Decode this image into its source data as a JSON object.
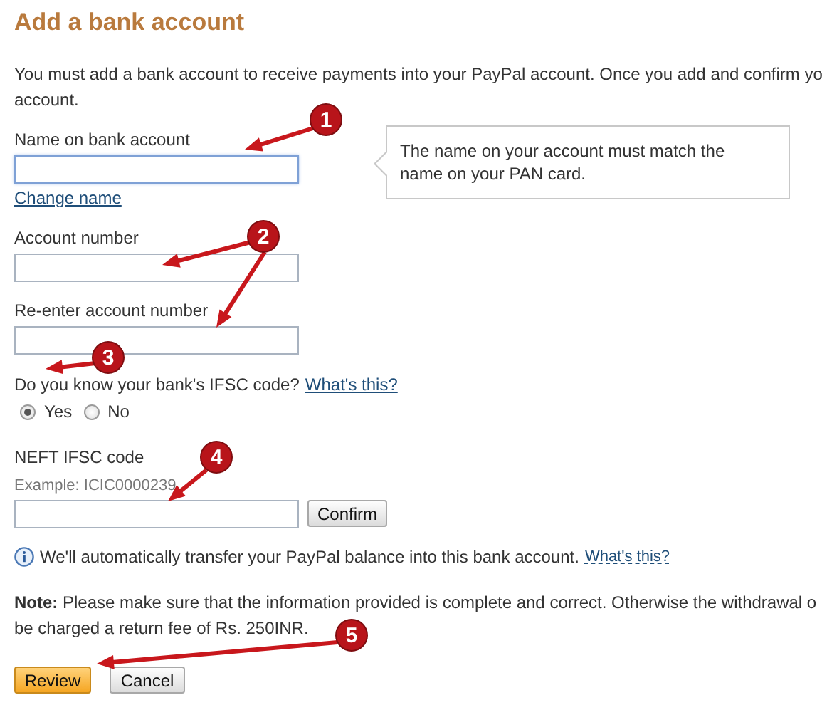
{
  "title": "Add a bank account",
  "intro": {
    "lines": [
      "You must add a bank account to receive payments into your PayPal account. Once you add and confirm yo",
      "account."
    ]
  },
  "fields": [
    {
      "label": "Name on bank account",
      "focused": true,
      "link": "Change name"
    },
    {
      "label": "Account number",
      "focused": false
    },
    {
      "label": "Re-enter account number",
      "focused": false
    }
  ],
  "tooltip": "The name on your account must match the name on your PAN card.",
  "ifsc_question": {
    "text": "Do you know your bank's IFSC code?",
    "link": "What's this?",
    "options": [
      {
        "label": "Yes",
        "selected": true
      },
      {
        "label": "No",
        "selected": false
      }
    ]
  },
  "ifsc_field": {
    "label": "NEFT IFSC code",
    "hint": "Example: ICIC0000239",
    "button": "Confirm"
  },
  "info": {
    "text": "We'll automatically transfer your PayPal balance into this bank account.",
    "link": "What's this?"
  },
  "note": {
    "lines": [
      "**Note:** Please make sure that the information provided is complete and correct. Otherwise the withdrawal o",
      "be charged a return fee of Rs. 250INR."
    ]
  },
  "buttons": [
    {
      "label": "Review",
      "kind": "primary"
    },
    {
      "label": "Cancel",
      "kind": "secondary"
    }
  ],
  "annotations": [
    "1",
    "2",
    "3",
    "4",
    "5"
  ]
}
